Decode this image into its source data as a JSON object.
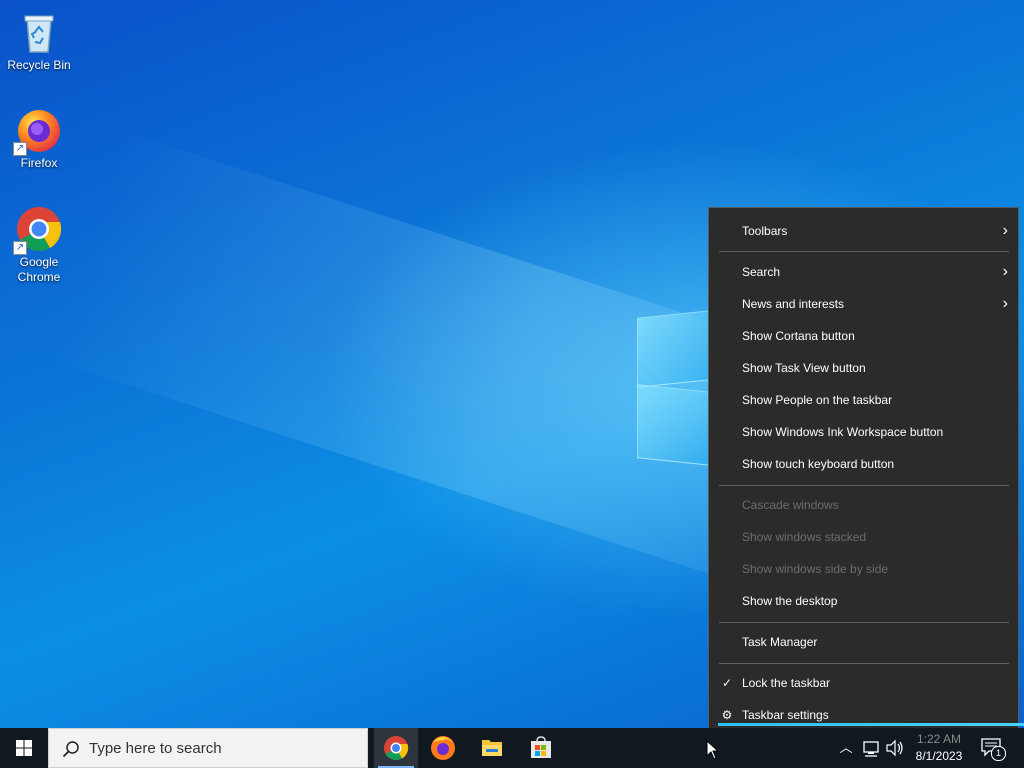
{
  "desktop": {
    "icons": [
      {
        "label": "Recycle Bin",
        "icon": "recycle-bin-icon"
      },
      {
        "label": "Firefox",
        "icon": "firefox-icon"
      },
      {
        "label": "Google Chrome",
        "icon": "chrome-icon"
      }
    ]
  },
  "context_menu": {
    "items": [
      {
        "label": "Toolbars",
        "submenu": true,
        "enabled": true
      },
      {
        "label": "Search",
        "submenu": true,
        "enabled": true
      },
      {
        "label": "News and interests",
        "submenu": true,
        "enabled": true
      },
      {
        "label": "Show Cortana button",
        "enabled": true
      },
      {
        "label": "Show Task View button",
        "enabled": true
      },
      {
        "label": "Show People on the taskbar",
        "enabled": true
      },
      {
        "label": "Show Windows Ink Workspace button",
        "enabled": true
      },
      {
        "label": "Show touch keyboard button",
        "enabled": true
      },
      {
        "label": "Cascade windows",
        "enabled": false
      },
      {
        "label": "Show windows stacked",
        "enabled": false
      },
      {
        "label": "Show windows side by side",
        "enabled": false
      },
      {
        "label": "Show the desktop",
        "enabled": true
      },
      {
        "label": "Task Manager",
        "enabled": true
      },
      {
        "label": "Lock the taskbar",
        "enabled": true,
        "checked": true
      },
      {
        "label": "Taskbar settings",
        "enabled": true,
        "icon": "gear-icon"
      }
    ]
  },
  "taskbar": {
    "search_placeholder": "Type here to search",
    "apps": [
      {
        "name": "Google Chrome",
        "icon": "chrome-icon",
        "active": true
      },
      {
        "name": "Firefox",
        "icon": "firefox-icon",
        "active": false
      },
      {
        "name": "File Explorer",
        "icon": "folder-icon",
        "active": false
      },
      {
        "name": "Microsoft Store",
        "icon": "store-icon",
        "active": false
      }
    ],
    "clock": {
      "time": "1:22 AM",
      "date": "8/1/2023"
    },
    "notification_count": "1"
  },
  "colors": {
    "menu_bg": "#2b2b2b",
    "taskbar_bg": "#101820",
    "accent": "#2cc0ff"
  }
}
